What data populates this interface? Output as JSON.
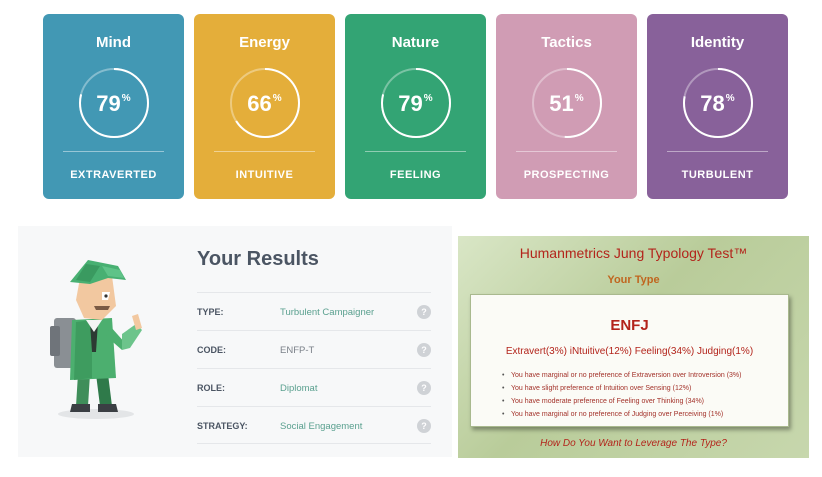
{
  "traits": [
    {
      "title": "Mind",
      "percent": 79,
      "unit": "%",
      "trait": "EXTRAVERTED",
      "color": "#4298b4"
    },
    {
      "title": "Energy",
      "percent": 66,
      "unit": "%",
      "trait": "INTUITIVE",
      "color": "#e4ae3a"
    },
    {
      "title": "Nature",
      "percent": 79,
      "unit": "%",
      "trait": "FEELING",
      "color": "#33a474"
    },
    {
      "title": "Tactics",
      "percent": 51,
      "unit": "%",
      "trait": "PROSPECTING",
      "color": "#d09cb4"
    },
    {
      "title": "Identity",
      "percent": 78,
      "unit": "%",
      "trait": "TURBULENT",
      "color": "#88619a"
    }
  ],
  "results": {
    "heading": "Your Results",
    "rows": [
      {
        "label": "TYPE:",
        "value": "Turbulent Campaigner",
        "help": "?"
      },
      {
        "label": "CODE:",
        "value": "ENFP-T",
        "help": "?"
      },
      {
        "label": "ROLE:",
        "value": "Diplomat",
        "help": "?"
      },
      {
        "label": "STRATEGY:",
        "value": "Social Engagement",
        "help": "?"
      }
    ]
  },
  "humanmetrics": {
    "title": "Humanmetrics Jung Typology Test™",
    "subtitle": "Your Type",
    "type": "ENFJ",
    "scores": "Extravert(3%)  iNtuitive(12%)  Feeling(34%)  Judging(1%)",
    "bullets": [
      "You have marginal or no preference of Extraversion over Introversion (3%)",
      "You have slight preference of Intuition over Sensing (12%)",
      "You have moderate preference of Feeling over Thinking (34%)",
      "You have marginal or no preference of Judging over Perceiving (1%)"
    ],
    "footer": "How Do You Want to Leverage The Type?"
  }
}
